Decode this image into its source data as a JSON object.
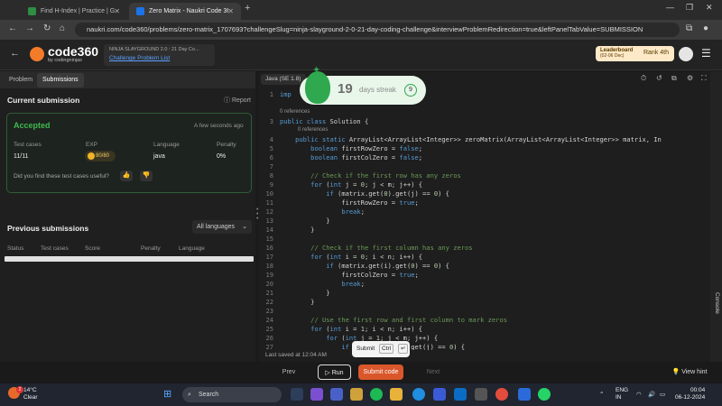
{
  "browser": {
    "tabs": [
      {
        "label": "Find H-Index | Practice | GeeksforGeeks",
        "favicon_color": "#2f8d46",
        "active": false
      },
      {
        "label": "Zero Matrix - Naukri Code 360",
        "favicon_color": "#1a73e8",
        "active": true
      }
    ],
    "url": "naukri.com/code360/problems/zero-matrix_1707693?challengeSlug=ninja-slayground-2-0-21-day-coding-challenge&interviewProblemRedirection=true&leftPanelTabValue=SUBMISSION"
  },
  "app": {
    "logo_title": "code360",
    "logo_sub": "by codingninjas",
    "challenge_title": "NINJA SLAYGROUND 2.0 : 21 Day Co...",
    "challenge_link": "Challenge Problem List",
    "leaderboard_label": "Leaderboard",
    "leaderboard_dates": "(02-06 Dec)",
    "rank": "Rank 4th"
  },
  "left": {
    "tabs": [
      "Problem",
      "Submissions"
    ],
    "current_title": "Current submission",
    "report": "Report",
    "status": "Accepted",
    "time_ago": "A few seconds ago",
    "labels": {
      "tests": "Test cases",
      "exp": "EXP",
      "language": "Language",
      "penalty": "Penalty"
    },
    "values": {
      "tests": "11/11",
      "exp": "80/80",
      "language": "java",
      "penalty": "0%"
    },
    "useful_q": "Did you find these test cases useful?",
    "previous_title": "Previous submissions",
    "lang_filter": "All languages",
    "columns": [
      "Status",
      "Test cases",
      "Score",
      "Penalty",
      "Language"
    ]
  },
  "editor": {
    "language": "Java (SE 1.8)",
    "streak_num": "19",
    "streak_label": "days streak",
    "streak_badge": "9",
    "refs": "0 references",
    "submit_tip": "Submit",
    "submit_key": "Ctrl",
    "submit_key2": "↵",
    "last_saved": "Last saved at 12:04 AM",
    "console": "Console"
  },
  "bottom": {
    "prev": "Prev",
    "run": "Run",
    "submit": "Submit code",
    "next": "Next",
    "hint": "View hint"
  },
  "taskbar": {
    "temp": "14°C",
    "weather": "Clear",
    "search": "Search",
    "lang": "ENG",
    "region": "IN",
    "time": "00:04",
    "date": "06-12-2024",
    "badge_count": "2"
  }
}
